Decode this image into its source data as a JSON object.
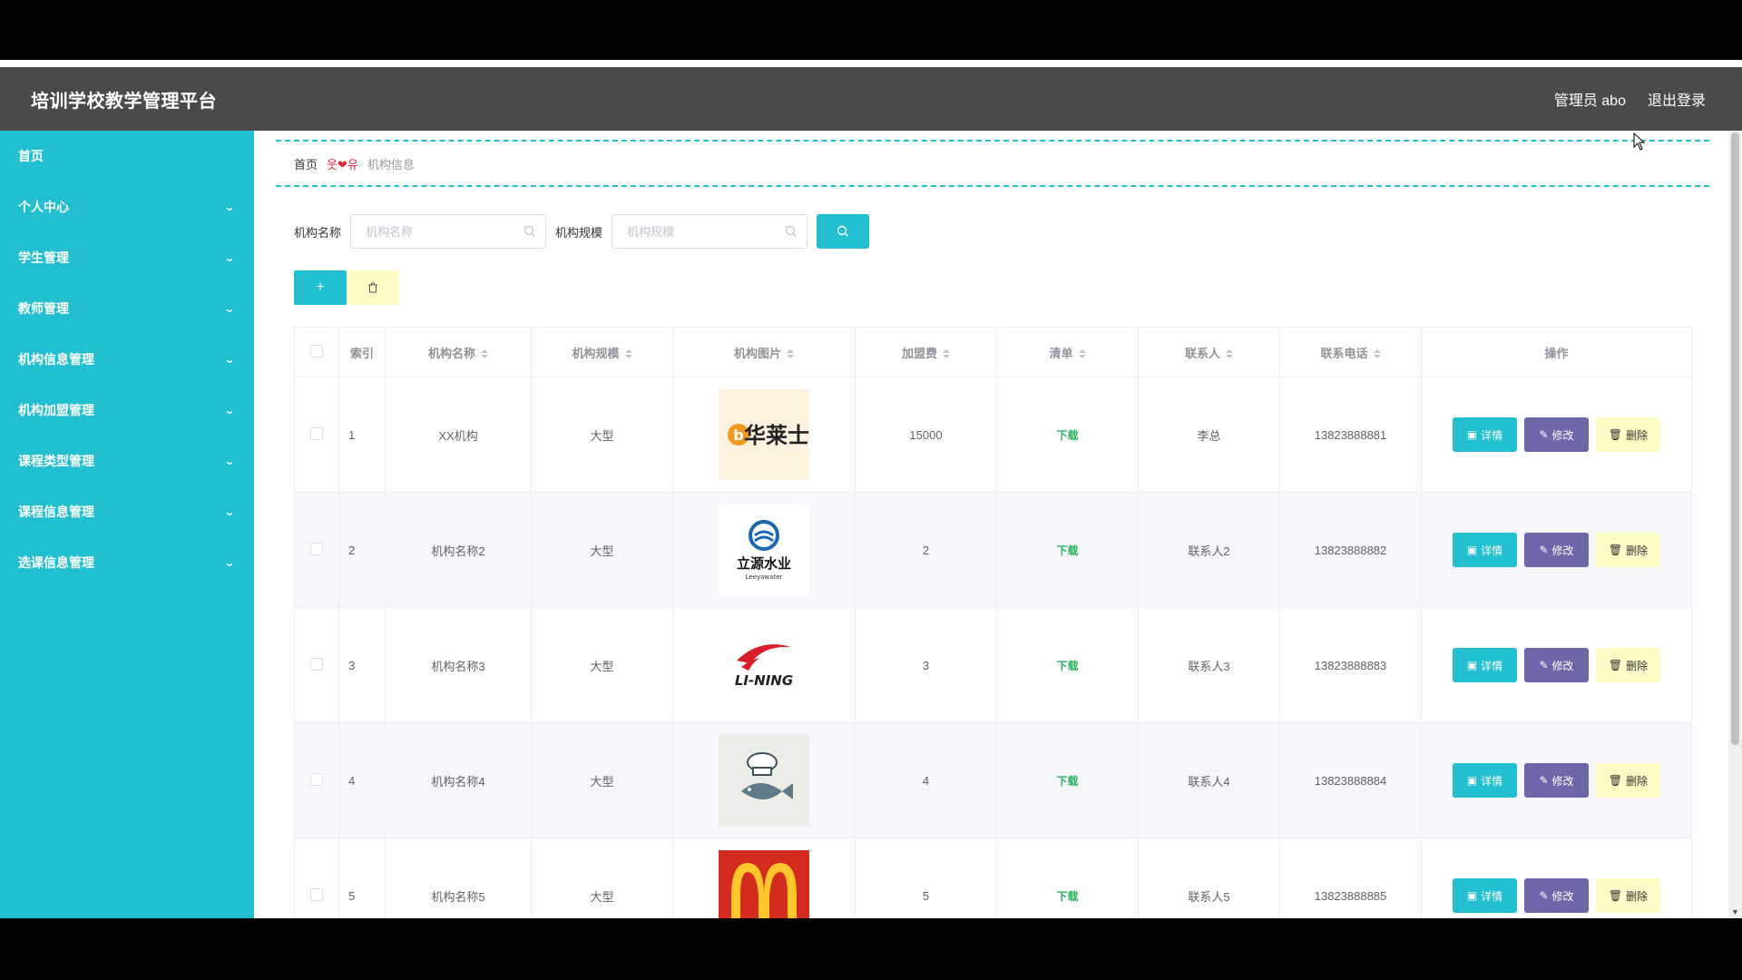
{
  "header": {
    "title": "培训学校教学管理平台",
    "user": "管理员 abo",
    "logout": "退出登录"
  },
  "sidebar": {
    "items": [
      {
        "label": "首页",
        "expandable": false
      },
      {
        "label": "个人中心",
        "expandable": true
      },
      {
        "label": "学生管理",
        "expandable": true
      },
      {
        "label": "教师管理",
        "expandable": true
      },
      {
        "label": "机构信息管理",
        "expandable": true
      },
      {
        "label": "机构加盟管理",
        "expandable": true
      },
      {
        "label": "课程类型管理",
        "expandable": true
      },
      {
        "label": "课程信息管理",
        "expandable": true
      },
      {
        "label": "选课信息管理",
        "expandable": true
      }
    ]
  },
  "breadcrumb": {
    "home": "首页",
    "separator": "웃❤유",
    "current": "机构信息"
  },
  "search": {
    "name_label": "机构名称",
    "name_placeholder": "机构名称",
    "scale_label": "机构规模",
    "scale_placeholder": "机构规模"
  },
  "table": {
    "headers": [
      "索引",
      "机构名称",
      "机构规模",
      "机构图片",
      "加盟费",
      "清单",
      "联系人",
      "联系电话",
      "操作"
    ],
    "rows": [
      {
        "index": "1",
        "name": "XX机构",
        "scale": "大型",
        "image": "huakeshi-logo",
        "fee": "15000",
        "list": "下载",
        "contact": "李总",
        "phone": "13823888881"
      },
      {
        "index": "2",
        "name": "机构名称2",
        "scale": "大型",
        "image": "liyuan-water-logo",
        "fee": "2",
        "list": "下载",
        "contact": "联系人2",
        "phone": "13823888882"
      },
      {
        "index": "3",
        "name": "机构名称3",
        "scale": "大型",
        "image": "li-ning-logo",
        "fee": "3",
        "list": "下载",
        "contact": "联系人3",
        "phone": "13823888883"
      },
      {
        "index": "4",
        "name": "机构名称4",
        "scale": "大型",
        "image": "fish-chef-logo",
        "fee": "4",
        "list": "下载",
        "contact": "联系人4",
        "phone": "13823888884"
      },
      {
        "index": "5",
        "name": "机构名称5",
        "scale": "大型",
        "image": "mcdonalds-logo",
        "fee": "5",
        "list": "下载",
        "contact": "联系人5",
        "phone": "13823888885"
      }
    ],
    "actions": {
      "detail": "详情",
      "edit": "修改",
      "delete": "删除"
    }
  },
  "colors": {
    "accent": "#22bfd0",
    "header_bg": "#4a4a4a",
    "edit": "#6b67a8",
    "delete_bg": "#fefcc6",
    "download": "#2db35d"
  }
}
